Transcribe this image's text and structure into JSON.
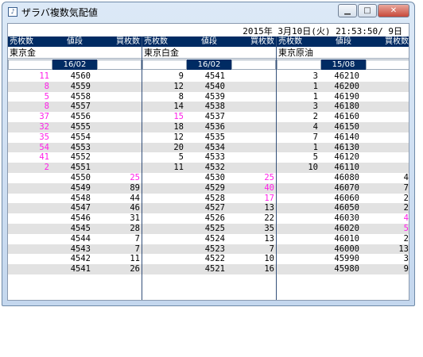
{
  "window": {
    "title": "ザラバ複数気配値",
    "icon": "app-icon",
    "controls": [
      "minimize",
      "maximize",
      "close"
    ]
  },
  "datetime": "2015年 3月10日(火) 21:53:50/ 9日",
  "columns": {
    "sell": "売枚数",
    "price": "値段",
    "buy": "買枚数"
  },
  "colors": {
    "header_bg": "#002b63",
    "highlight": "#ff1fe8",
    "alt_row": "#e2e2e2"
  },
  "panels": [
    {
      "name": "東京金",
      "month": "16/02",
      "rows": [
        {
          "sell": "11",
          "price": "4560",
          "buy": "",
          "sc": "pink",
          "bc": ""
        },
        {
          "sell": "8",
          "price": "4559",
          "buy": "",
          "sc": "pink",
          "bc": ""
        },
        {
          "sell": "5",
          "price": "4558",
          "buy": "",
          "sc": "pink",
          "bc": ""
        },
        {
          "sell": "8",
          "price": "4557",
          "buy": "",
          "sc": "pink",
          "bc": ""
        },
        {
          "sell": "37",
          "price": "4556",
          "buy": "",
          "sc": "pink",
          "bc": ""
        },
        {
          "sell": "32",
          "price": "4555",
          "buy": "",
          "sc": "pink",
          "bc": ""
        },
        {
          "sell": "35",
          "price": "4554",
          "buy": "",
          "sc": "pink",
          "bc": ""
        },
        {
          "sell": "54",
          "price": "4553",
          "buy": "",
          "sc": "pink",
          "bc": ""
        },
        {
          "sell": "41",
          "price": "4552",
          "buy": "",
          "sc": "pink",
          "bc": ""
        },
        {
          "sell": "2",
          "price": "4551",
          "buy": "",
          "sc": "pink",
          "bc": ""
        },
        {
          "sell": "",
          "price": "4550",
          "buy": "25",
          "sc": "",
          "bc": "pink"
        },
        {
          "sell": "",
          "price": "4549",
          "buy": "89",
          "sc": "",
          "bc": ""
        },
        {
          "sell": "",
          "price": "4548",
          "buy": "44",
          "sc": "",
          "bc": ""
        },
        {
          "sell": "",
          "price": "4547",
          "buy": "46",
          "sc": "",
          "bc": ""
        },
        {
          "sell": "",
          "price": "4546",
          "buy": "31",
          "sc": "",
          "bc": ""
        },
        {
          "sell": "",
          "price": "4545",
          "buy": "28",
          "sc": "",
          "bc": ""
        },
        {
          "sell": "",
          "price": "4544",
          "buy": "7",
          "sc": "",
          "bc": ""
        },
        {
          "sell": "",
          "price": "4543",
          "buy": "7",
          "sc": "",
          "bc": ""
        },
        {
          "sell": "",
          "price": "4542",
          "buy": "11",
          "sc": "",
          "bc": ""
        },
        {
          "sell": "",
          "price": "4541",
          "buy": "26",
          "sc": "",
          "bc": ""
        }
      ]
    },
    {
      "name": "東京白金",
      "month": "16/02",
      "rows": [
        {
          "sell": "9",
          "price": "4541",
          "buy": "",
          "sc": "",
          "bc": ""
        },
        {
          "sell": "12",
          "price": "4540",
          "buy": "",
          "sc": "",
          "bc": ""
        },
        {
          "sell": "8",
          "price": "4539",
          "buy": "",
          "sc": "",
          "bc": ""
        },
        {
          "sell": "14",
          "price": "4538",
          "buy": "",
          "sc": "",
          "bc": ""
        },
        {
          "sell": "15",
          "price": "4537",
          "buy": "",
          "sc": "pink",
          "bc": ""
        },
        {
          "sell": "18",
          "price": "4536",
          "buy": "",
          "sc": "",
          "bc": ""
        },
        {
          "sell": "12",
          "price": "4535",
          "buy": "",
          "sc": "",
          "bc": ""
        },
        {
          "sell": "20",
          "price": "4534",
          "buy": "",
          "sc": "",
          "bc": ""
        },
        {
          "sell": "5",
          "price": "4533",
          "buy": "",
          "sc": "",
          "bc": ""
        },
        {
          "sell": "11",
          "price": "4532",
          "buy": "",
          "sc": "",
          "bc": ""
        },
        {
          "sell": "",
          "price": "4530",
          "buy": "25",
          "sc": "",
          "bc": "pink"
        },
        {
          "sell": "",
          "price": "4529",
          "buy": "40",
          "sc": "",
          "bc": "pink"
        },
        {
          "sell": "",
          "price": "4528",
          "buy": "17",
          "sc": "",
          "bc": "pink"
        },
        {
          "sell": "",
          "price": "4527",
          "buy": "13",
          "sc": "",
          "bc": ""
        },
        {
          "sell": "",
          "price": "4526",
          "buy": "22",
          "sc": "",
          "bc": ""
        },
        {
          "sell": "",
          "price": "4525",
          "buy": "35",
          "sc": "",
          "bc": ""
        },
        {
          "sell": "",
          "price": "4524",
          "buy": "13",
          "sc": "",
          "bc": ""
        },
        {
          "sell": "",
          "price": "4523",
          "buy": "7",
          "sc": "",
          "bc": ""
        },
        {
          "sell": "",
          "price": "4522",
          "buy": "10",
          "sc": "",
          "bc": ""
        },
        {
          "sell": "",
          "price": "4521",
          "buy": "16",
          "sc": "",
          "bc": ""
        }
      ]
    },
    {
      "name": "東京原油",
      "month": "15/08",
      "rows": [
        {
          "sell": "3",
          "price": "46210",
          "buy": "",
          "sc": "",
          "bc": ""
        },
        {
          "sell": "1",
          "price": "46200",
          "buy": "",
          "sc": "",
          "bc": ""
        },
        {
          "sell": "1",
          "price": "46190",
          "buy": "",
          "sc": "",
          "bc": ""
        },
        {
          "sell": "3",
          "price": "46180",
          "buy": "",
          "sc": "",
          "bc": ""
        },
        {
          "sell": "2",
          "price": "46160",
          "buy": "",
          "sc": "",
          "bc": ""
        },
        {
          "sell": "4",
          "price": "46150",
          "buy": "",
          "sc": "",
          "bc": ""
        },
        {
          "sell": "7",
          "price": "46140",
          "buy": "",
          "sc": "",
          "bc": ""
        },
        {
          "sell": "1",
          "price": "46130",
          "buy": "",
          "sc": "",
          "bc": ""
        },
        {
          "sell": "5",
          "price": "46120",
          "buy": "",
          "sc": "",
          "bc": ""
        },
        {
          "sell": "10",
          "price": "46110",
          "buy": "",
          "sc": "",
          "bc": ""
        },
        {
          "sell": "",
          "price": "46080",
          "buy": "4",
          "sc": "",
          "bc": ""
        },
        {
          "sell": "",
          "price": "46070",
          "buy": "7",
          "sc": "",
          "bc": ""
        },
        {
          "sell": "",
          "price": "46060",
          "buy": "2",
          "sc": "",
          "bc": ""
        },
        {
          "sell": "",
          "price": "46050",
          "buy": "2",
          "sc": "",
          "bc": ""
        },
        {
          "sell": "",
          "price": "46030",
          "buy": "4",
          "sc": "",
          "bc": "pink"
        },
        {
          "sell": "",
          "price": "46020",
          "buy": "5",
          "sc": "",
          "bc": "pink"
        },
        {
          "sell": "",
          "price": "46010",
          "buy": "2",
          "sc": "",
          "bc": ""
        },
        {
          "sell": "",
          "price": "46000",
          "buy": "13",
          "sc": "",
          "bc": ""
        },
        {
          "sell": "",
          "price": "45990",
          "buy": "3",
          "sc": "",
          "bc": ""
        },
        {
          "sell": "",
          "price": "45980",
          "buy": "9",
          "sc": "",
          "bc": ""
        }
      ]
    }
  ]
}
